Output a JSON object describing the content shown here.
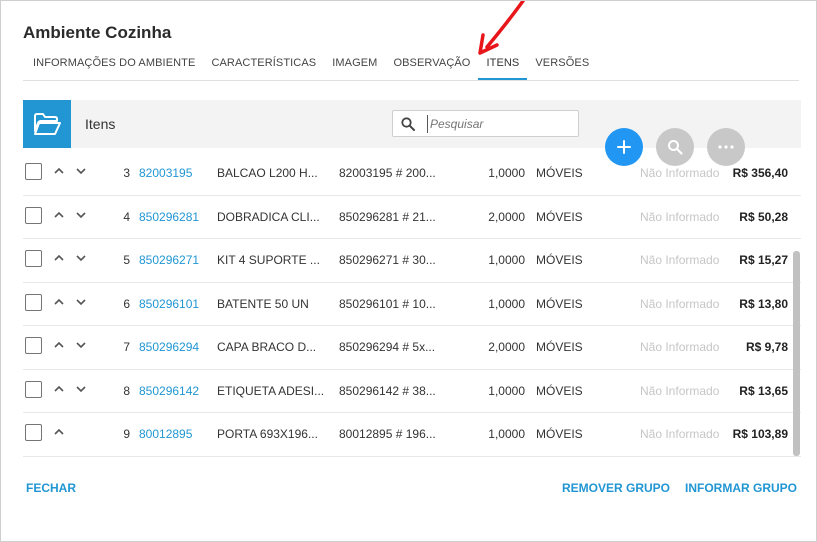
{
  "window": {
    "title": "Ambiente Cozinha"
  },
  "tabs": [
    {
      "label": "INFORMAÇÕES DO AMBIENTE"
    },
    {
      "label": "CARACTERÍSTICAS"
    },
    {
      "label": "IMAGEM"
    },
    {
      "label": "OBSERVAÇÃO"
    },
    {
      "label": "ITENS"
    },
    {
      "label": "VERSÕES"
    }
  ],
  "active_tab": "ITENS",
  "section": {
    "label": "Itens",
    "search_placeholder": "Pesquisar"
  },
  "colors": {
    "accent": "#2196d3",
    "fab_primary": "#2196f3",
    "fab_secondary": "#c8c8c8",
    "annotation_arrow": "#e8161b"
  },
  "icons": {
    "section": "folder-open-icon",
    "search": "search-icon",
    "add": "plus-icon",
    "search_fab": "search-icon",
    "more": "more-horizontal-icon",
    "move_up": "chevron-up-icon",
    "move_down": "chevron-down-icon"
  },
  "rows": [
    {
      "index": "3",
      "code": "82003195",
      "description": "BALCAO L200 H...",
      "reference": "82003195 # 200...",
      "quantity": "1,0000",
      "category": "MÓVEIS",
      "info": "Não Informado",
      "price": "R$ 356,40"
    },
    {
      "index": "4",
      "code": "850296281",
      "description": "DOBRADICA CLI...",
      "reference": "850296281 # 21...",
      "quantity": "2,0000",
      "category": "MÓVEIS",
      "info": "Não Informado",
      "price": "R$ 50,28"
    },
    {
      "index": "5",
      "code": "850296271",
      "description": "KIT 4 SUPORTE ...",
      "reference": "850296271 # 30...",
      "quantity": "1,0000",
      "category": "MÓVEIS",
      "info": "Não Informado",
      "price": "R$ 15,27"
    },
    {
      "index": "6",
      "code": "850296101",
      "description": "BATENTE 50 UN",
      "reference": "850296101 # 10...",
      "quantity": "1,0000",
      "category": "MÓVEIS",
      "info": "Não Informado",
      "price": "R$ 13,80"
    },
    {
      "index": "7",
      "code": "850296294",
      "description": "CAPA BRACO D...",
      "reference": "850296294 # 5x...",
      "quantity": "2,0000",
      "category": "MÓVEIS",
      "info": "Não Informado",
      "price": "R$ 9,78"
    },
    {
      "index": "8",
      "code": "850296142",
      "description": "ETIQUETA ADESI...",
      "reference": "850296142 # 38...",
      "quantity": "1,0000",
      "category": "MÓVEIS",
      "info": "Não Informado",
      "price": "R$ 13,65"
    },
    {
      "index": "9",
      "code": "80012895",
      "description": "PORTA 693X196...",
      "reference": "80012895 # 196...",
      "quantity": "1,0000",
      "category": "MÓVEIS",
      "info": "Não Informado",
      "price": "R$ 103,89"
    }
  ],
  "footer": {
    "close_label": "FECHAR",
    "remove_group_label": "REMOVER GRUPO",
    "inform_group_label": "INFORMAR GRUPO"
  }
}
